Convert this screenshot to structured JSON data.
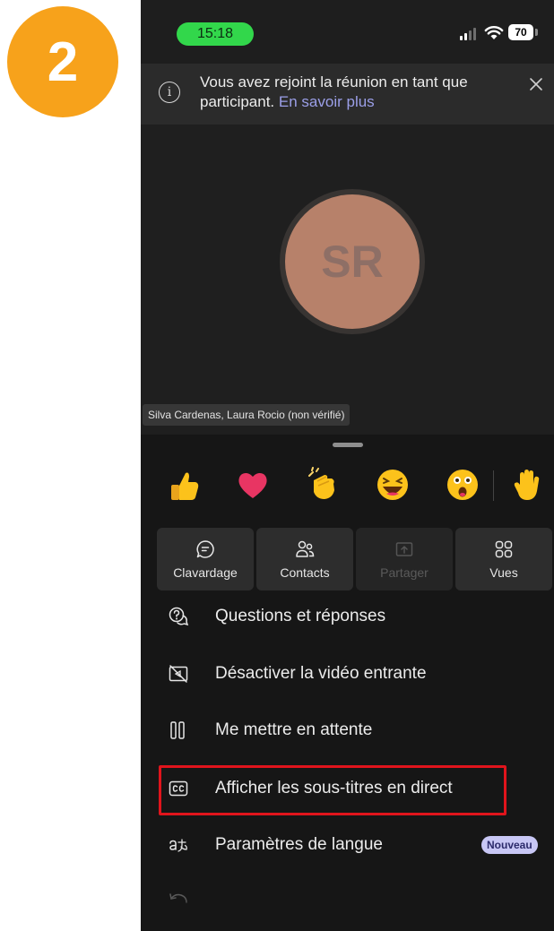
{
  "step_badge": {
    "number": "2",
    "color": "#f7a21b"
  },
  "status_bar": {
    "time": "15:18",
    "battery": "70"
  },
  "banner": {
    "text": "Vous avez rejoint la réunion en tant que participant.",
    "link": "En savoir plus"
  },
  "participant": {
    "initials": "SR",
    "name": "Silva Cardenas, Laura Rocio (non vérifié)"
  },
  "reactions": [
    {
      "icon": "thumbs-up-icon"
    },
    {
      "icon": "heart-icon"
    },
    {
      "icon": "clapping-hands-icon"
    },
    {
      "icon": "laughing-face-icon"
    },
    {
      "icon": "surprised-face-icon"
    },
    {
      "icon": "raise-hand-icon"
    }
  ],
  "tiles": [
    {
      "label": "Clavardage",
      "icon": "chat-icon",
      "enabled": true
    },
    {
      "label": "Contacts",
      "icon": "people-icon",
      "enabled": true
    },
    {
      "label": "Partager",
      "icon": "share-screen-icon",
      "enabled": false
    },
    {
      "label": "Vues",
      "icon": "grid-view-icon",
      "enabled": true
    }
  ],
  "menu": [
    {
      "label": "Questions et réponses",
      "icon": "qa-icon"
    },
    {
      "label": "Désactiver la vidéo entrante",
      "icon": "video-off-icon"
    },
    {
      "label": "Me mettre en attente",
      "icon": "pause-icon"
    },
    {
      "label": "Afficher les sous-titres en direct",
      "icon": "closed-captions-icon",
      "highlighted": true
    },
    {
      "label": "Paramètres de langue",
      "icon": "language-icon",
      "badge": "Nouveau"
    },
    {
      "label": "",
      "icon": "rotate-icon"
    }
  ],
  "colors": {
    "highlight": "#e0141c",
    "avatar": "#b7816a",
    "link": "#9b9fe8",
    "time_pill": "#32d74b"
  }
}
